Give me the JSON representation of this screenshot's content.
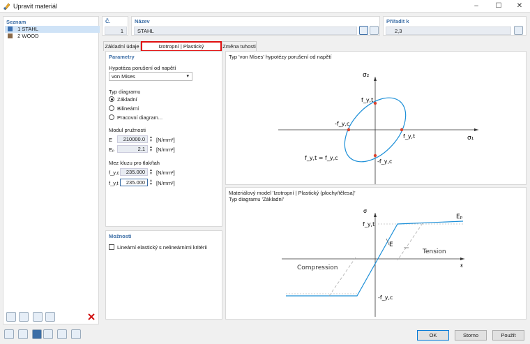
{
  "window": {
    "title": "Upravit materiál",
    "minimize": "–",
    "maximize": "☐",
    "close": "✕"
  },
  "list": {
    "header": "Seznam",
    "items": [
      {
        "num": "1",
        "name": "STAHL",
        "color": "#3a6fb0"
      },
      {
        "num": "2",
        "name": "WOOD",
        "color": "#8a6a4a"
      }
    ]
  },
  "header": {
    "no_label": "Č.",
    "no_value": "1",
    "name_label": "Název",
    "name_value": "STAHL",
    "assigned_label": "Přiřadit k",
    "assigned_value": "2,3"
  },
  "tabs": [
    {
      "label": "Základní údaje"
    },
    {
      "label": "Izotropní | Plastický (plochy/tělesa)"
    },
    {
      "label": "Změna tuhosti"
    }
  ],
  "parameters": {
    "title": "Parametry",
    "hypothesis_label": "Hypotéza porušení od napětí",
    "hypothesis_value": "von Mises",
    "diagram_type_label": "Typ diagramu",
    "diagram_options": [
      "Základní",
      "Bilineární",
      "Pracovní diagram..."
    ],
    "selected_diagram": 0,
    "elastic_modulus_label": "Modul pružnosti",
    "E_label": "E",
    "E_value": "210000.0",
    "E_unit": "[N/mm²]",
    "Ep_label": "Eₚ",
    "Ep_value": "2.1",
    "Ep_unit": "[N/mm²]",
    "yield_label": "Mez kluzu pro tlak/tah",
    "fyc_label": "f_y,c",
    "fyc_value": "235.000",
    "fyc_unit": "[N/mm²]",
    "fyt_label": "f_y,t",
    "fyt_value": "235.000",
    "fyt_unit": "[N/mm²]"
  },
  "options": {
    "title": "Možnosti",
    "linear_elastic_label": "Lineární elastický s nelineárními kritérii"
  },
  "diagram1": {
    "caption": "Typ 'von Mises' hypotézy porušení od napětí",
    "sigma2": "σ₂",
    "sigma1": "σ₁",
    "fyt_top": "f_y,t",
    "fyc_left": "-f_y,c",
    "fyt_right": "f_y,t",
    "fyc_bottom": "-f_y,c",
    "equation": "f_y,t = f_y,c"
  },
  "diagram2": {
    "caption_line1": "Materiálový model 'Izotropní | Plastický (plochy/tělesa)'",
    "caption_line2": "Typ diagramu 'Základní'",
    "sigma": "σ",
    "epsilon": "ε",
    "fyt": "f_y,t",
    "fyc": "-f_y,c",
    "E": "E",
    "Ep": "Eₚ",
    "tension": "Tension",
    "compression": "Compression"
  },
  "buttons": {
    "ok": "OK",
    "cancel": "Storno",
    "apply": "Použít"
  },
  "colors": {
    "accent": "#3c6ea6",
    "highlight": "#e01010",
    "curve": "#1e90d8",
    "point": "#d9412b"
  }
}
